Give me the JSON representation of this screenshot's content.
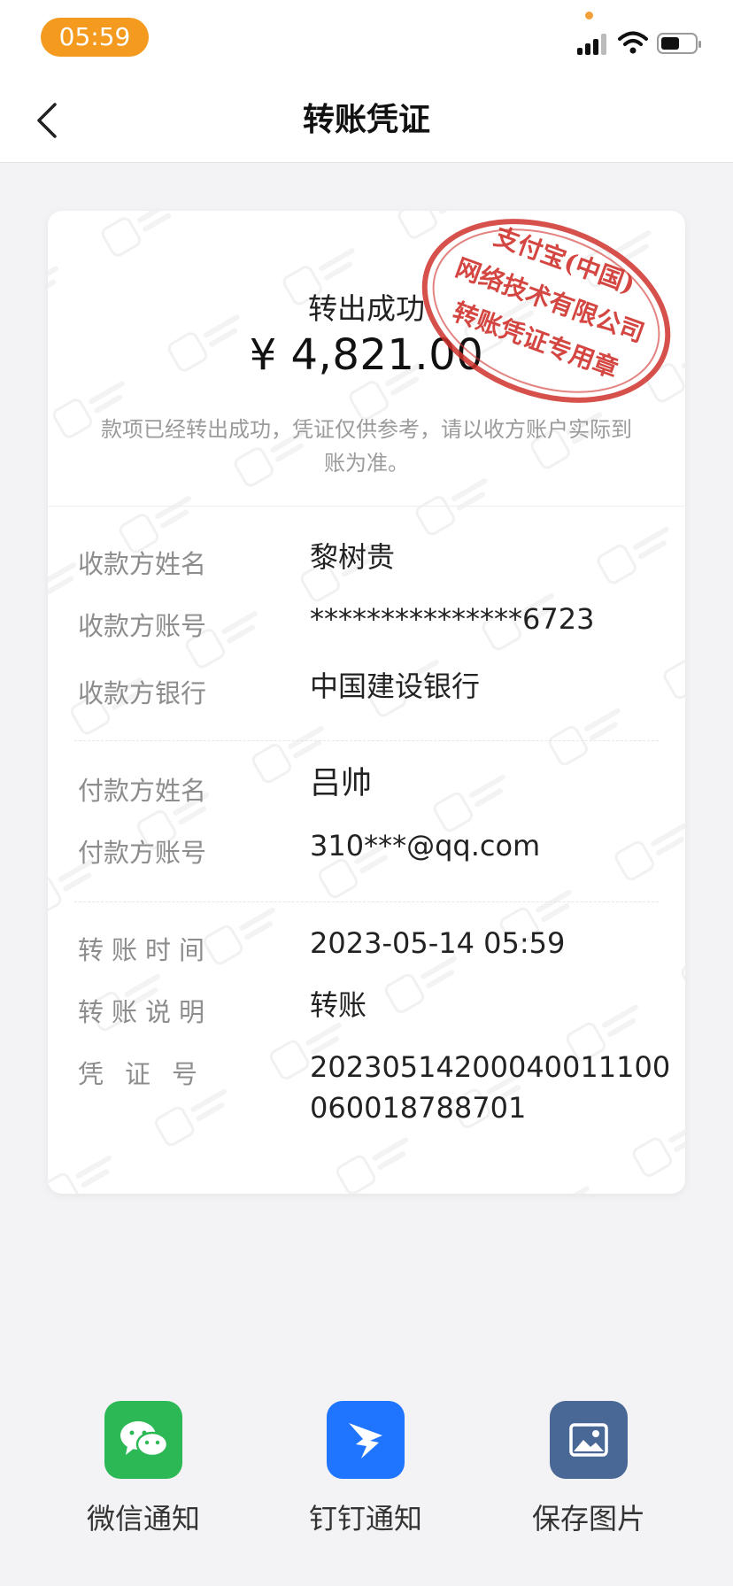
{
  "status_bar": {
    "time": "05:59"
  },
  "nav": {
    "title": "转账凭证"
  },
  "receipt": {
    "status": "转出成功",
    "amount": "¥ 4,821.00",
    "notice": "款项已经转出成功，凭证仅供参考，请以收方账户实际到账为准。",
    "stamp": {
      "line1": "支付宝(中国)",
      "line2": "网络技术有限公司",
      "line3": "转账凭证专用章",
      "color": "#d0322d"
    },
    "payee": {
      "name_label": "收款方姓名",
      "name": "黎树贵",
      "account_label": "收款方账号",
      "account": "***************6723",
      "bank_label": "收款方银行",
      "bank": "中国建设银行"
    },
    "payer": {
      "name_label": "付款方姓名",
      "name": "吕帅",
      "account_label": "付款方账号",
      "account": "310***@qq.com"
    },
    "details": {
      "time_label": "转账时间",
      "time": "2023-05-14 05:59",
      "memo_label": "转账说明",
      "memo": "转账",
      "voucher_label": "凭证号",
      "voucher": "20230514200040011100060018788701"
    }
  },
  "share": {
    "wechat_label": "微信通知",
    "dingtalk_label": "钉钉通知",
    "save_label": "保存图片",
    "wechat_color": "#2db856",
    "dingtalk_color": "#1f75ff",
    "save_color": "#4a6896"
  }
}
